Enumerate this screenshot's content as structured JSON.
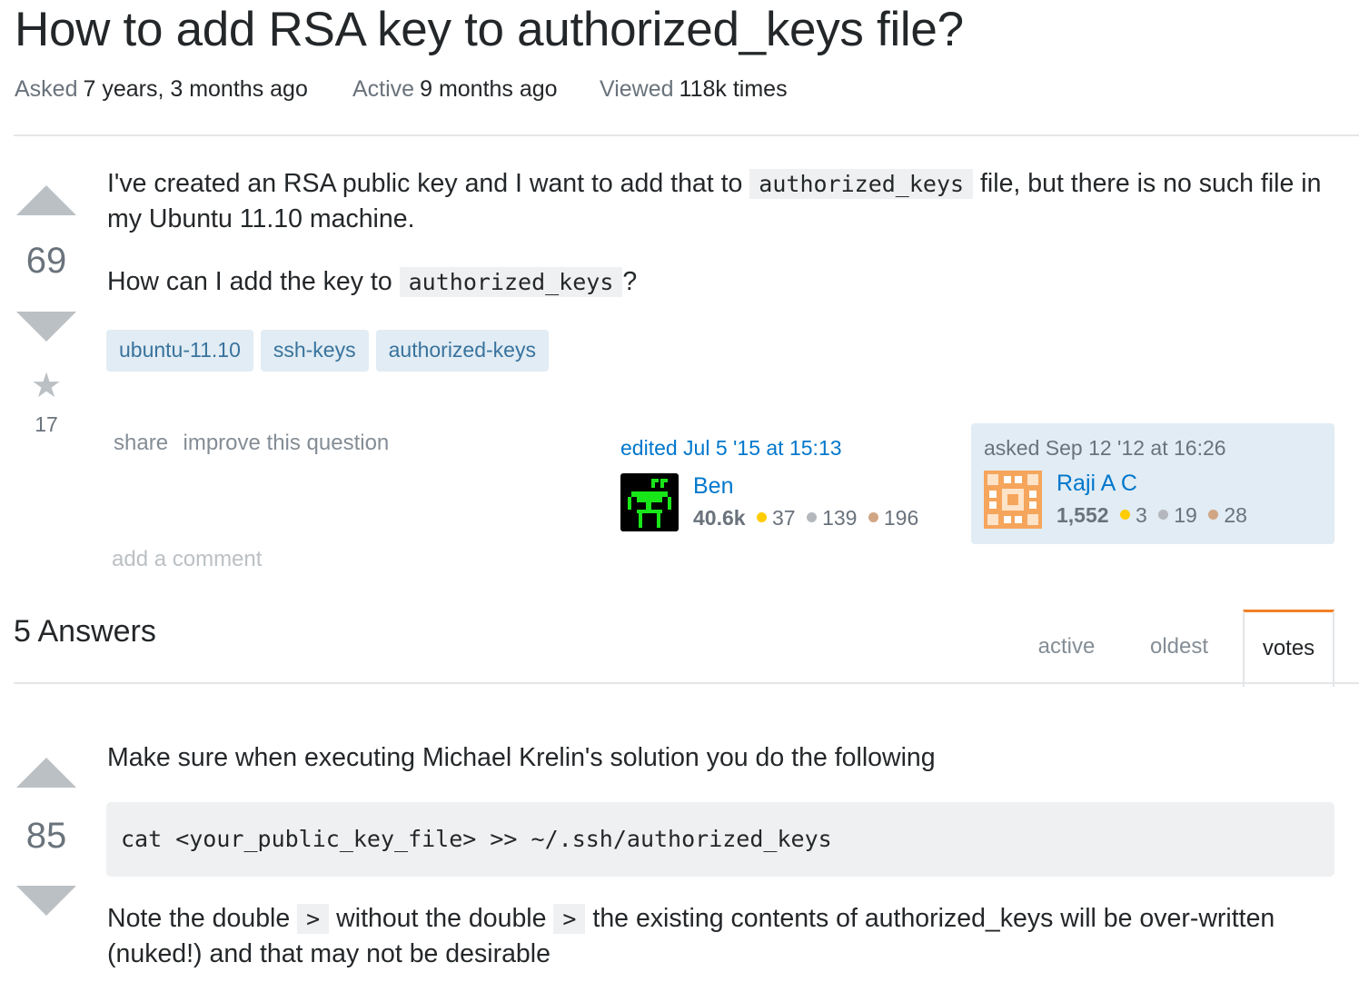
{
  "question": {
    "title": "How to add RSA key to authorized_keys file?",
    "meta": {
      "asked_label": "Asked",
      "asked_value": "7 years, 3 months ago",
      "active_label": "Active",
      "active_value": "9 months ago",
      "viewed_label": "Viewed",
      "viewed_value": "118k times"
    },
    "votes": "69",
    "favorites": "17",
    "body": {
      "p1_before": "I've created an RSA public key and I want to add that to ",
      "p1_code": "authorized_keys",
      "p1_after": " file, but there is no such file in my Ubuntu 11.10 machine.",
      "p2_before": "How can I add the key to ",
      "p2_code": "authorized_keys",
      "p2_after": "?"
    },
    "tags": [
      "ubuntu-11.10",
      "ssh-keys",
      "authorized-keys"
    ],
    "menu": {
      "share": "share",
      "improve": "improve this question"
    },
    "editor": {
      "action": "edited Jul 5 '15 at 15:13",
      "name": "Ben",
      "rep": "40.6k",
      "gold": "37",
      "silver": "139",
      "bronze": "196"
    },
    "owner": {
      "action": "asked Sep 12 '12 at 16:26",
      "name": "Raji A C",
      "rep": "1,552",
      "gold": "3",
      "silver": "19",
      "bronze": "28"
    },
    "add_comment": "add a comment"
  },
  "answers_header": {
    "count_label": "5 Answers",
    "tabs": [
      "active",
      "oldest",
      "votes"
    ],
    "active_tab": "votes"
  },
  "answer": {
    "votes": "85",
    "intro": "Make sure when executing Michael Krelin's solution you do the following",
    "code": "cat <your_public_key_file> >> ~/.ssh/authorized_keys",
    "note_a": "Note the double ",
    "note_code1": ">",
    "note_b": " without the double ",
    "note_code2": ">",
    "note_c": " the existing contents of authorized_keys will be over-written (nuked!) and that may not be desirable"
  },
  "colors": {
    "badge_gold": "#ffcc01",
    "badge_silver": "#b4b8bc",
    "badge_bronze": "#d1a684",
    "tag_bg": "#e1ecf4",
    "tag_text": "#39739d",
    "link": "#0077cc",
    "accent_orange": "#f48024"
  }
}
